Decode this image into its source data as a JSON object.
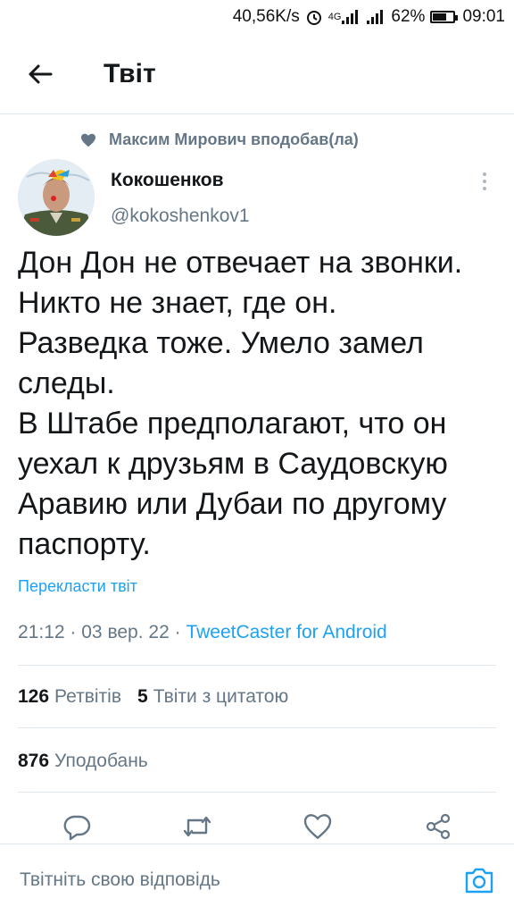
{
  "status_bar": {
    "speed": "40,56K/s",
    "network": "4G",
    "battery_percent": "62%",
    "battery_level": 0.62,
    "time": "09:01"
  },
  "header": {
    "title": "Твіт",
    "back_icon": "arrow-left-icon"
  },
  "liked_by": {
    "icon": "heart-icon",
    "text": "Максим Мирович вподобав(ла)"
  },
  "tweet": {
    "author_name": "Кокошенков",
    "author_handle": "@kokoshenkov1",
    "text": "Дон Дон не отвечает на звонки.\nНикто не знает, где он.\nРазведка тоже. Умело замел\nследы.\nВ Штабе предполагают, что он\nуехал к друзьям в Саудовскую\nАравию или Дубаи по другому\nпаспорту.",
    "translate_label": "Перекласти твіт",
    "time": "21:12",
    "date": "03 вер. 22",
    "separator": "·",
    "source": "TweetCaster for Android"
  },
  "stats": {
    "retweets_count": "126",
    "retweets_label": "Ретвітів",
    "quotes_count": "5",
    "quotes_label": "Твіти з цитатою",
    "likes_count": "876",
    "likes_label": "Уподобань"
  },
  "actions": {
    "reply_icon": "reply-icon",
    "retweet_icon": "retweet-icon",
    "like_icon": "heart-icon",
    "share_icon": "share-icon"
  },
  "reply_bar": {
    "placeholder": "Твітніть свою відповідь",
    "camera_icon": "camera-icon"
  },
  "colors": {
    "accent": "#1da1f2",
    "secondary_text": "#657786",
    "primary_text": "#14171a",
    "divider": "#e1e8ed"
  }
}
